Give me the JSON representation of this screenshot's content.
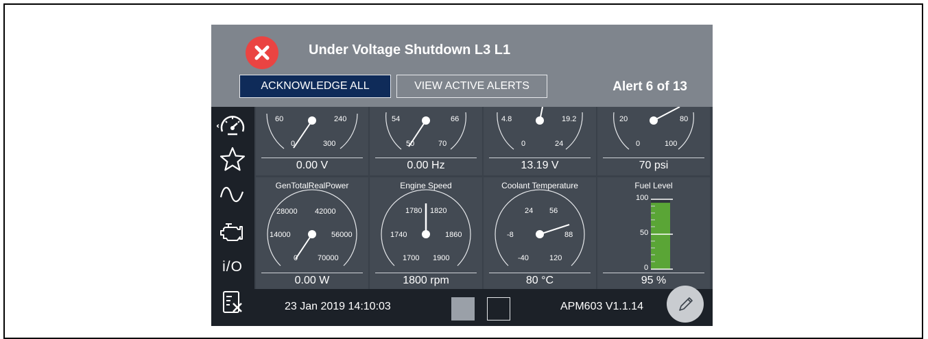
{
  "alert": {
    "icon": "error-x-icon",
    "title": "Under Voltage Shutdown L3 L1",
    "acknowledge_label": "ACKNOWLEDGE ALL",
    "view_label": "VIEW ACTIVE ALERTS",
    "counter": "Alert 6 of 13"
  },
  "sidebar": {
    "items": [
      {
        "icon": "speedometer-icon"
      },
      {
        "icon": "star-icon"
      },
      {
        "icon": "sine-wave-icon"
      },
      {
        "icon": "engine-icon"
      },
      {
        "icon": "io-icon",
        "label": "i/O"
      },
      {
        "icon": "settings-document-icon"
      }
    ]
  },
  "gauges_top": [
    {
      "ticks": [
        "60",
        "240",
        "0",
        "300"
      ],
      "value": "0.00 V"
    },
    {
      "ticks": [
        "54",
        "66",
        "50",
        "70"
      ],
      "value": "0.00 Hz"
    },
    {
      "ticks": [
        "4.8",
        "19.2",
        "0",
        "24"
      ],
      "value": "13.19 V"
    },
    {
      "ticks": [
        "20",
        "80",
        "0",
        "100"
      ],
      "value": "70 psi"
    }
  ],
  "gauges_bottom": [
    {
      "title": "GenTotalRealPower",
      "ticks": [
        "28000",
        "42000",
        "14000",
        "56000",
        "0",
        "70000"
      ],
      "value": "0.00 W"
    },
    {
      "title": "Engine Speed",
      "ticks": [
        "1780",
        "1820",
        "1740",
        "1860",
        "1700",
        "1900"
      ],
      "value": "1800 rpm"
    },
    {
      "title": "Coolant Temperature",
      "ticks": [
        "24",
        "56",
        "-8",
        "88",
        "-40",
        "120"
      ],
      "value": "80 °C"
    },
    {
      "title": "Fuel Level",
      "ticks": [
        "100",
        "50",
        "0"
      ],
      "value": "95 %",
      "fill_fraction": 0.95
    }
  ],
  "status": {
    "datetime": "23 Jan 2019 14:10:03",
    "version": "APM603 V1.1.14",
    "edit_icon": "pencil-icon"
  },
  "colors": {
    "alert_bar": "#7f858d",
    "alert_icon": "#ea4442",
    "ack_button": "#0f2b59",
    "panel": "#434a53",
    "background": "#3a414a",
    "sidebar": "#1c2128",
    "fuel_fill": "#5aa536"
  }
}
